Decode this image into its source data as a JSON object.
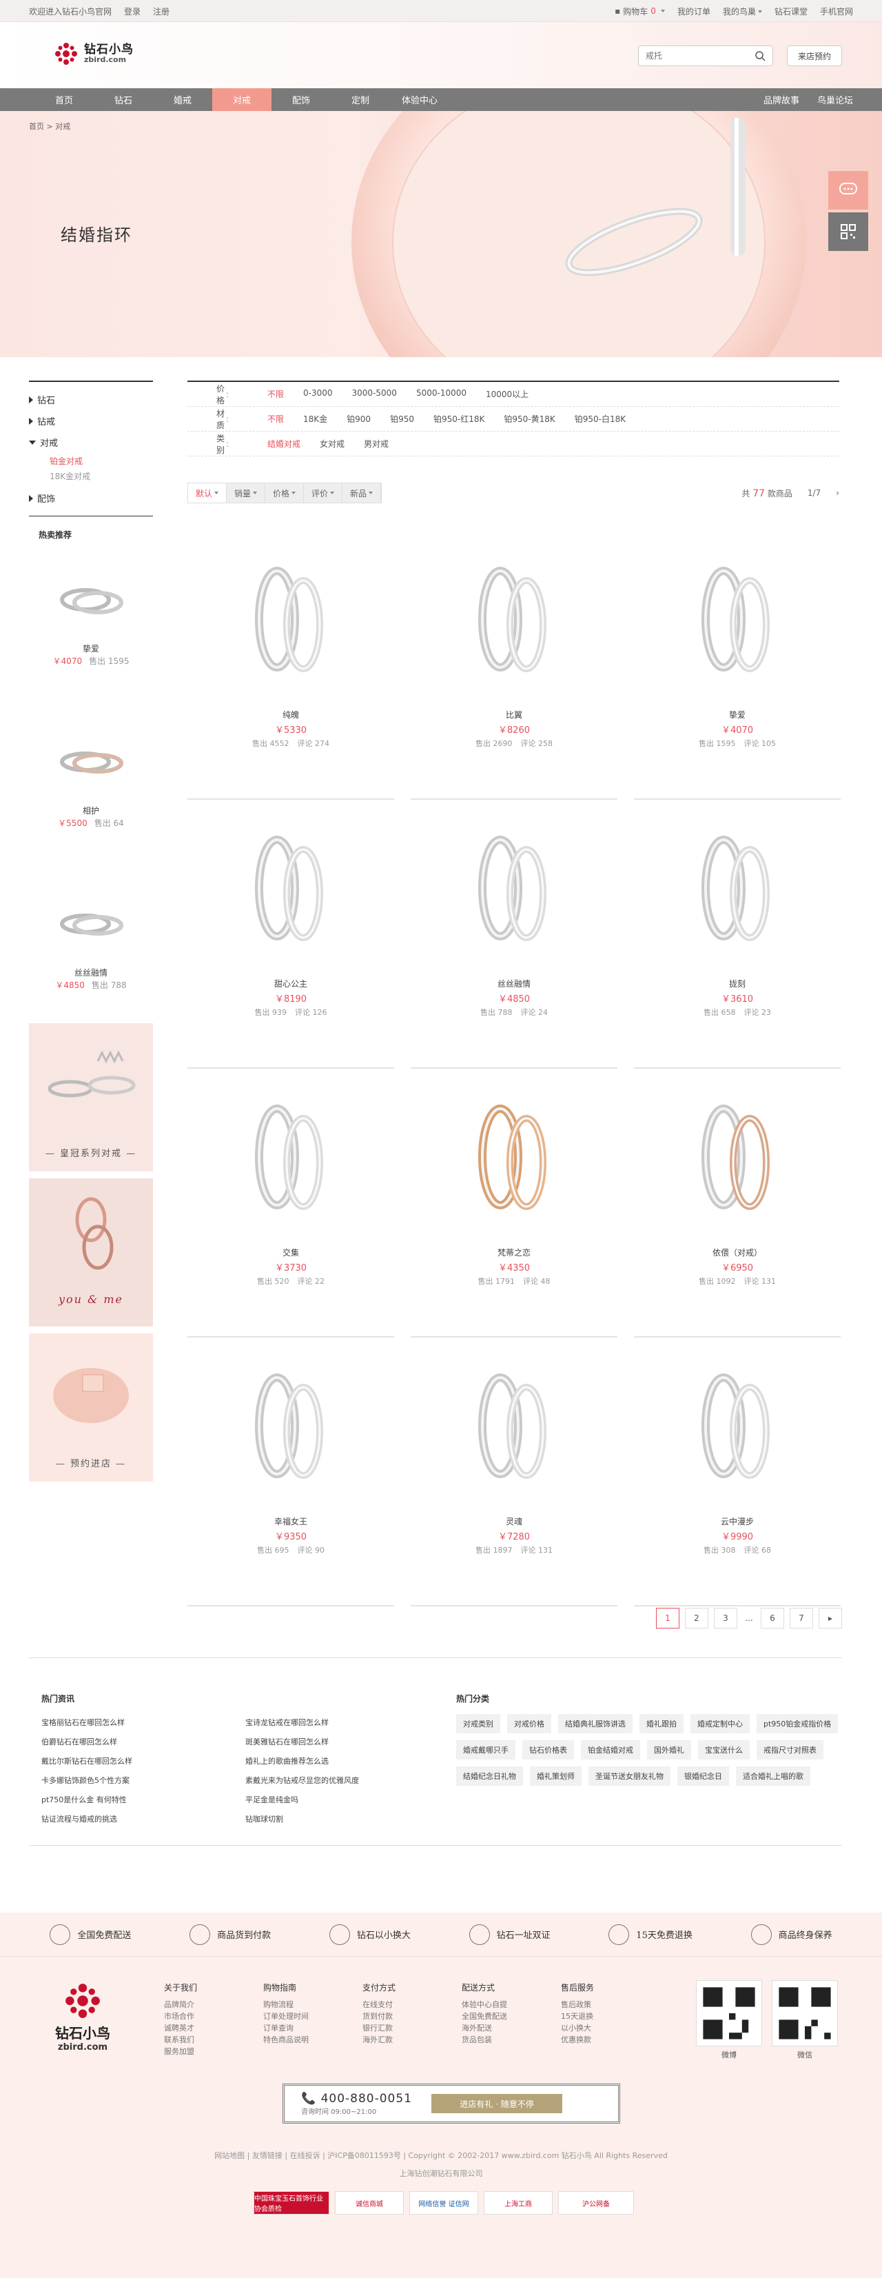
{
  "topbar": {
    "welcome": "欢迎进入钻石小鸟官网",
    "login": "登录",
    "register": "注册",
    "cart_label": "购物车",
    "cart_count": "0",
    "orders": "我的订单",
    "my_account": "我的鸟巢",
    "academy": "钻石课堂",
    "mobile": "手机官网"
  },
  "header": {
    "logo_cn": "钻石小鸟",
    "logo_en": "zbird.com",
    "search_placeholder": "戒托",
    "store_button": "来店预约"
  },
  "nav": {
    "items": [
      "首页",
      "钻石",
      "婚戒",
      "对戒",
      "配饰",
      "定制",
      "体验中心"
    ],
    "active_index": 3,
    "right": [
      "品牌故事",
      "鸟巢论坛"
    ]
  },
  "banner": {
    "crumb_home": "首页",
    "crumb_sep": ">",
    "crumb_current": "对戒",
    "title": "结婚指环"
  },
  "sidebar": {
    "categories": [
      {
        "label": "钻石"
      },
      {
        "label": "钻戒"
      },
      {
        "label": "对戒"
      },
      {
        "label": "配饰"
      }
    ],
    "subs": [
      "铂金对戒",
      "18K金对戒"
    ],
    "hot_title": "热卖推荐",
    "hot_items": [
      {
        "name": "挚爱",
        "price": "￥4070",
        "sold": "售出 1595"
      },
      {
        "name": "相护",
        "price": "￥5500",
        "sold": "售出 64"
      },
      {
        "name": "丝丝融情",
        "price": "￥4850",
        "sold": "售出 788"
      }
    ],
    "promos": [
      "— 皇冠系列对戒 —",
      "you & me",
      "— 预约进店 —"
    ]
  },
  "filters": [
    {
      "label": "价格",
      "options": [
        "不限",
        "0-3000",
        "3000-5000",
        "5000-10000",
        "10000以上"
      ]
    },
    {
      "label": "材质",
      "options": [
        "不限",
        "18K金",
        "铂900",
        "铂950",
        "铂950-红18K",
        "铂950-黄18K",
        "铂950-白18K"
      ]
    },
    {
      "label": "类别",
      "options": [
        "结婚对戒",
        "女对戒",
        "男对戒"
      ]
    }
  ],
  "sortbar": {
    "sorts": [
      "默认",
      "销量",
      "价格",
      "评价",
      "新品"
    ],
    "total_prefix": "共",
    "total": "77",
    "total_suffix": "款商品",
    "page": "1/7"
  },
  "products": [
    {
      "name": "纯魄",
      "price": "￥5330",
      "sold": "售出 4552",
      "reviews": "评论 274"
    },
    {
      "name": "比翼",
      "price": "￥8260",
      "sold": "售出 2690",
      "reviews": "评论 258"
    },
    {
      "name": "挚爱",
      "price": "￥4070",
      "sold": "售出 1595",
      "reviews": "评论 105"
    },
    {
      "name": "甜心公主",
      "price": "￥8190",
      "sold": "售出 939",
      "reviews": "评论 126"
    },
    {
      "name": "丝丝融情",
      "price": "￥4850",
      "sold": "售出 788",
      "reviews": "评论 24"
    },
    {
      "name": "拢刻",
      "price": "￥3610",
      "sold": "售出 658",
      "reviews": "评论 23"
    },
    {
      "name": "交集",
      "price": "￥3730",
      "sold": "售出 520",
      "reviews": "评论 22"
    },
    {
      "name": "梵蒂之恋",
      "price": "￥4350",
      "sold": "售出 1791",
      "reviews": "评论 48"
    },
    {
      "name": "依偎（对戒）",
      "price": "￥6950",
      "sold": "售出 1092",
      "reviews": "评论 131"
    },
    {
      "name": "幸福女王",
      "price": "￥9350",
      "sold": "售出 695",
      "reviews": "评论 90"
    },
    {
      "name": "灵魂",
      "price": "￥7280",
      "sold": "售出 1897",
      "reviews": "评论 131"
    },
    {
      "name": "云中漫步",
      "price": "￥9990",
      "sold": "售出 308",
      "reviews": "评论 68"
    }
  ],
  "pager": [
    "1",
    "2",
    "3",
    "...",
    "6",
    "7",
    "▸"
  ],
  "news": {
    "title": "热门资讯",
    "items": [
      "宝格丽钻石在哪回怎么样",
      "宝诗龙钻戒在哪回怎么样",
      "伯爵钻石在哪回怎么样",
      "斑美雅钻石在哪回怎么样",
      "戴比尔斯钻石在哪回怎么样",
      "婚礼上的歌曲推荐怎么选",
      "卡多娜钻饰颜色5个性方案",
      "素戴光来为钻戒尽显您的优雅风度",
      "pt750是什么金 有何特性",
      "平足金是纯金吗",
      "钻证流程与婚戒的挑选",
      "钻咖球切割"
    ]
  },
  "hot_categories": {
    "title": "热门分类",
    "tags": [
      "对戒类别",
      "对戒价格",
      "结婚典礼服饰讲选",
      "婚礼跟拍",
      "婚戒定制中心",
      "pt950铂金戒指价格",
      "婚戒戴哪只手",
      "钻石价格表",
      "铂金结婚对戒",
      "国外婚礼",
      "宝宝送什么",
      "戒指尺寸对照表",
      "结婚纪念日礼物",
      "婚礼策划师",
      "圣诞节送女朋友礼物",
      "银婚纪念日",
      "适合婚礼上唱的歌"
    ]
  },
  "footer": {
    "guarantees": [
      "全国免费配送",
      "商品货到付款",
      "钻石以小换大",
      "钻石一址双证",
      "15天免费退换",
      "商品终身保养"
    ],
    "logo_cn": "钻石小鸟",
    "logo_en": "zbird.com",
    "cols": [
      {
        "title": "关于我们",
        "items": [
          "品牌简介",
          "市场合作",
          "诚聘英才",
          "联系我们",
          "服务加盟"
        ]
      },
      {
        "title": "购物指南",
        "items": [
          "购物流程",
          "订单处理时间",
          "订单查询",
          "特色商品说明"
        ]
      },
      {
        "title": "支付方式",
        "items": [
          "在线支付",
          "货到付款",
          "银行汇款",
          "海外汇款"
        ]
      },
      {
        "title": "配送方式",
        "items": [
          "体验中心自提",
          "全国免费配送",
          "海外配送",
          "货品包装"
        ]
      },
      {
        "title": "售后服务",
        "items": [
          "售后政策",
          "15天退换",
          "以小换大",
          "优惠换款"
        ]
      }
    ],
    "qr": [
      "微博",
      "微信"
    ],
    "phone": "400-880-0051",
    "phone_hours": "咨询时间 09:00~21:00",
    "phone_btn": "进店有礼 · 随意不停",
    "links": "网站地图 | 友情链接 | 在线投诉 | 沪ICP备08011593号 | Copyright © 2002-2017 www.zbird.com 钻石小鸟 All Rights Reserved",
    "company": "上海钻创潮钻石有限公司",
    "badges": [
      "中国珠宝玉石首饰行业协会质检",
      "诚信商城",
      "网络信誉 证信网",
      "上海工商",
      "沪公网备"
    ]
  }
}
